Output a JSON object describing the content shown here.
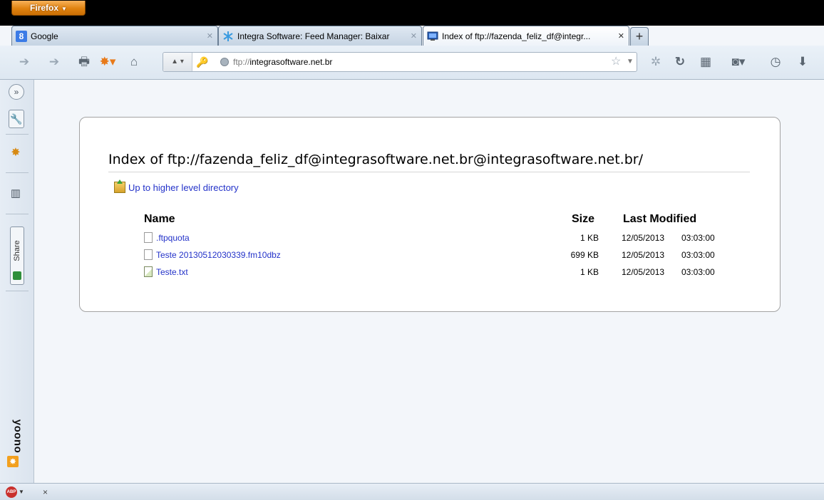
{
  "browser": {
    "menu_button": "Firefox",
    "tabs": [
      {
        "label": "Google",
        "favicon_letter": "8"
      },
      {
        "label": "Integra Software: Feed Manager: Baixar",
        "favicon": "snowflake-icon"
      },
      {
        "label": "Index of ftp://fazenda_feliz_df@integr...",
        "favicon": "monitor-icon"
      }
    ],
    "new_tab_label": "+",
    "url_prefix": "ftp://",
    "url_host": "integrasoftware.net.br",
    "identity_label": "▲ ▾"
  },
  "sidebar": {
    "share_label": "Share",
    "yoono_label": "yoono"
  },
  "page": {
    "title": "Index of ftp://fazenda_feliz_df@integrasoftware.net.br@integrasoftware.net.br/",
    "up_link": "Up to higher level directory",
    "columns": {
      "name": "Name",
      "size": "Size",
      "modified": "Last Modified"
    },
    "files": [
      {
        "name": ".ftpquota",
        "size": "1 KB",
        "date": "12/05/2013",
        "time": "03:03:00",
        "type": "file"
      },
      {
        "name": "Teste 20130512030339.fm10dbz",
        "size": "699 KB",
        "date": "12/05/2013",
        "time": "03:03:00",
        "type": "file"
      },
      {
        "name": "Teste.txt",
        "size": "1 KB",
        "date": "12/05/2013",
        "time": "03:03:00",
        "type": "text"
      }
    ]
  },
  "statusbar": {
    "adblock_label": "ABP",
    "close_label": "×"
  }
}
